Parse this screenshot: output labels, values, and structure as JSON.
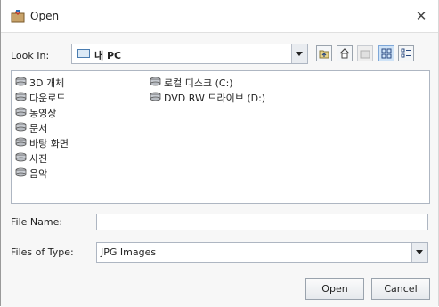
{
  "window": {
    "title": "Open",
    "close_glyph": "✕"
  },
  "toolbar": {
    "look_in_label": "Look In:",
    "look_in_value": "내 PC",
    "buttons": [
      "up-one-level-icon",
      "home-icon",
      "new-folder-icon",
      "list-view-icon",
      "details-view-icon"
    ]
  },
  "file_list": {
    "items": [
      {
        "label": "3D 개체",
        "icon": "drive-icon"
      },
      {
        "label": "다운로드",
        "icon": "drive-icon"
      },
      {
        "label": "동영상",
        "icon": "drive-icon"
      },
      {
        "label": "문서",
        "icon": "drive-icon"
      },
      {
        "label": "바탕 화면",
        "icon": "drive-icon"
      },
      {
        "label": "사진",
        "icon": "drive-icon"
      },
      {
        "label": "음악",
        "icon": "drive-icon"
      },
      {
        "label": "로컬 디스크 (C:)",
        "icon": "drive-icon"
      },
      {
        "label": "DVD RW 드라이브 (D:)",
        "icon": "drive-icon"
      }
    ]
  },
  "form": {
    "file_name_label": "File Name:",
    "file_name_value": "",
    "file_type_label": "Files of Type:",
    "file_type_value": "JPG Images"
  },
  "buttons": {
    "open_label": "Open",
    "cancel_label": "Cancel"
  }
}
